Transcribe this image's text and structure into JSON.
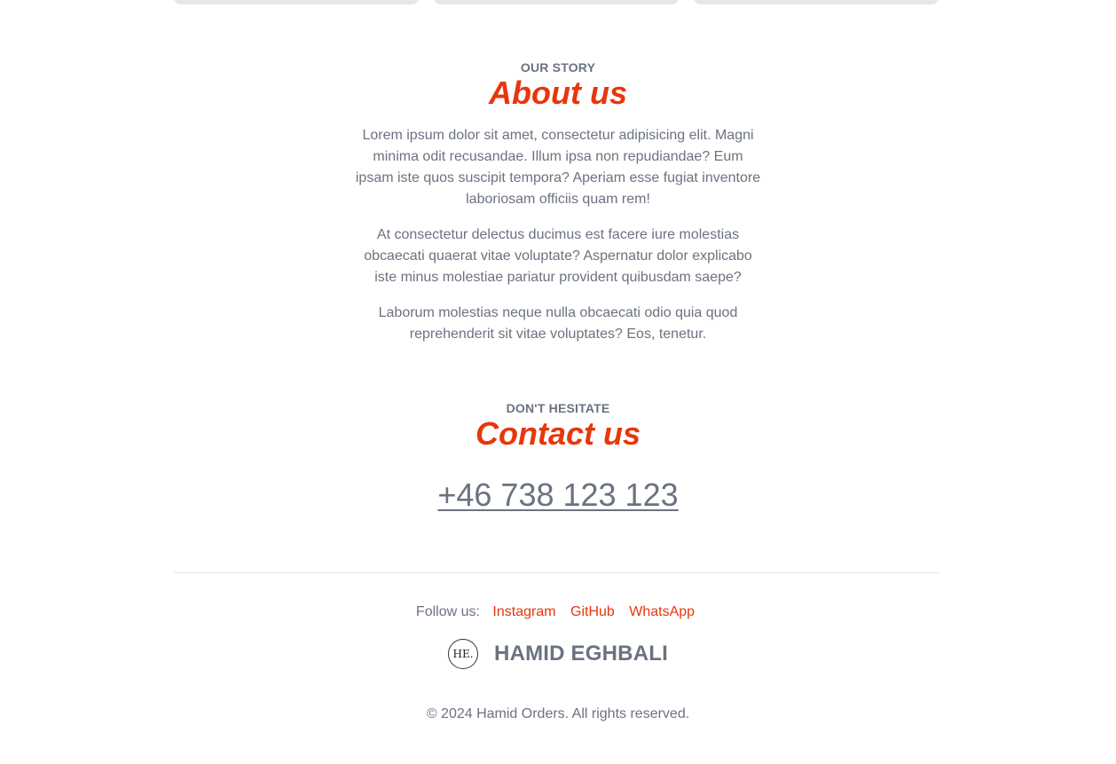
{
  "about": {
    "eyebrow": "OUR STORY",
    "title": "About us",
    "paragraphs": [
      "Lorem ipsum dolor sit amet, consectetur adipisicing elit. Magni minima odit recusandae. Illum ipsa non repudiandae? Eum ipsam iste quos suscipit tempora? Aperiam esse fugiat inventore laboriosam officiis quam rem!",
      "At consectetur delectus ducimus est facere iure molestias obcaecati quaerat vitae voluptate? Aspernatur dolor explicabo iste minus molestiae pariatur provident quibusdam saepe?",
      "Laborum molestias neque nulla obcaecati odio quia quod reprehenderit sit vitae voluptates? Eos, tenetur."
    ]
  },
  "contact": {
    "eyebrow": "DON'T HESITATE",
    "title": "Contact us",
    "phone": "+46 738 123 123"
  },
  "footer": {
    "follow_label": "Follow us:",
    "links": [
      "Instagram",
      "GitHub",
      "WhatsApp"
    ],
    "logo_text": "HE.",
    "brand_name": "HAMID EGHBALI",
    "copyright": "© 2024 Hamid Orders. All rights reserved."
  },
  "colors": {
    "accent": "#e8360c",
    "text": "#6b7280",
    "divider": "#e5e7eb"
  }
}
